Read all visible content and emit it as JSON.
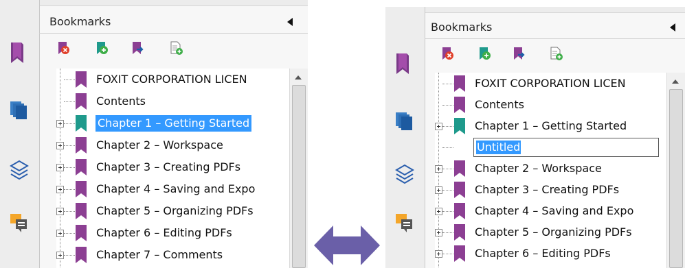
{
  "panels": [
    {
      "header": {
        "title": "Bookmarks"
      },
      "items": [
        {
          "label": "FOXIT CORPORATION LICEN",
          "color": "#8c3f93",
          "selected": false,
          "expandable": false
        },
        {
          "label": "Contents",
          "color": "#8c3f93",
          "selected": false,
          "expandable": false
        },
        {
          "label": "Chapter 1 – Getting Started",
          "color": "#1f9a8c",
          "selected": true,
          "expandable": true
        },
        {
          "label": "Chapter 2 – Workspace",
          "color": "#8c3f93",
          "selected": false,
          "expandable": true
        },
        {
          "label": "Chapter 3 – Creating PDFs",
          "color": "#8c3f93",
          "selected": false,
          "expandable": true
        },
        {
          "label": "Chapter 4 – Saving and Expo",
          "color": "#8c3f93",
          "selected": false,
          "expandable": true
        },
        {
          "label": "Chapter 5 – Organizing PDFs",
          "color": "#8c3f93",
          "selected": false,
          "expandable": true
        },
        {
          "label": "Chapter 6 – Editing PDFs",
          "color": "#8c3f93",
          "selected": false,
          "expandable": true
        },
        {
          "label": "Chapter 7 – Comments",
          "color": "#8c3f93",
          "selected": false,
          "expandable": true
        }
      ]
    },
    {
      "header": {
        "title": "Bookmarks"
      },
      "items": [
        {
          "label": "FOXIT CORPORATION LICEN",
          "color": "#8c3f93",
          "selected": false,
          "expandable": false
        },
        {
          "label": "Contents",
          "color": "#8c3f93",
          "selected": false,
          "expandable": false
        },
        {
          "label": "Chapter 1 – Getting Started",
          "color": "#1f9a8c",
          "selected": false,
          "expandable": true
        },
        {
          "label": "Untitled",
          "color": "#8c3f93",
          "selected": false,
          "expandable": false,
          "editing": true
        },
        {
          "label": "Chapter 2 – Workspace",
          "color": "#8c3f93",
          "selected": false,
          "expandable": true
        },
        {
          "label": "Chapter 3 – Creating PDFs",
          "color": "#8c3f93",
          "selected": false,
          "expandable": true
        },
        {
          "label": "Chapter 4 – Saving and Expo",
          "color": "#8c3f93",
          "selected": false,
          "expandable": true
        },
        {
          "label": "Chapter 5 – Organizing PDFs",
          "color": "#8c3f93",
          "selected": false,
          "expandable": true
        },
        {
          "label": "Chapter 6 – Editing PDFs",
          "color": "#8c3f93",
          "selected": false,
          "expandable": true
        }
      ]
    }
  ],
  "toolbar_icons": [
    "delete-bookmark-icon",
    "add-bookmark-icon",
    "move-bookmark-icon",
    "new-bookmark-from-page-icon"
  ],
  "sidebar_icons": [
    "bookmarks-icon",
    "pages-icon",
    "layers-icon",
    "comments-icon"
  ],
  "colors": {
    "selection": "#3399ff",
    "bookmark_purple": "#8c3f93",
    "bookmark_teal": "#1f9a8c",
    "arrow": "#6a5fa8"
  }
}
